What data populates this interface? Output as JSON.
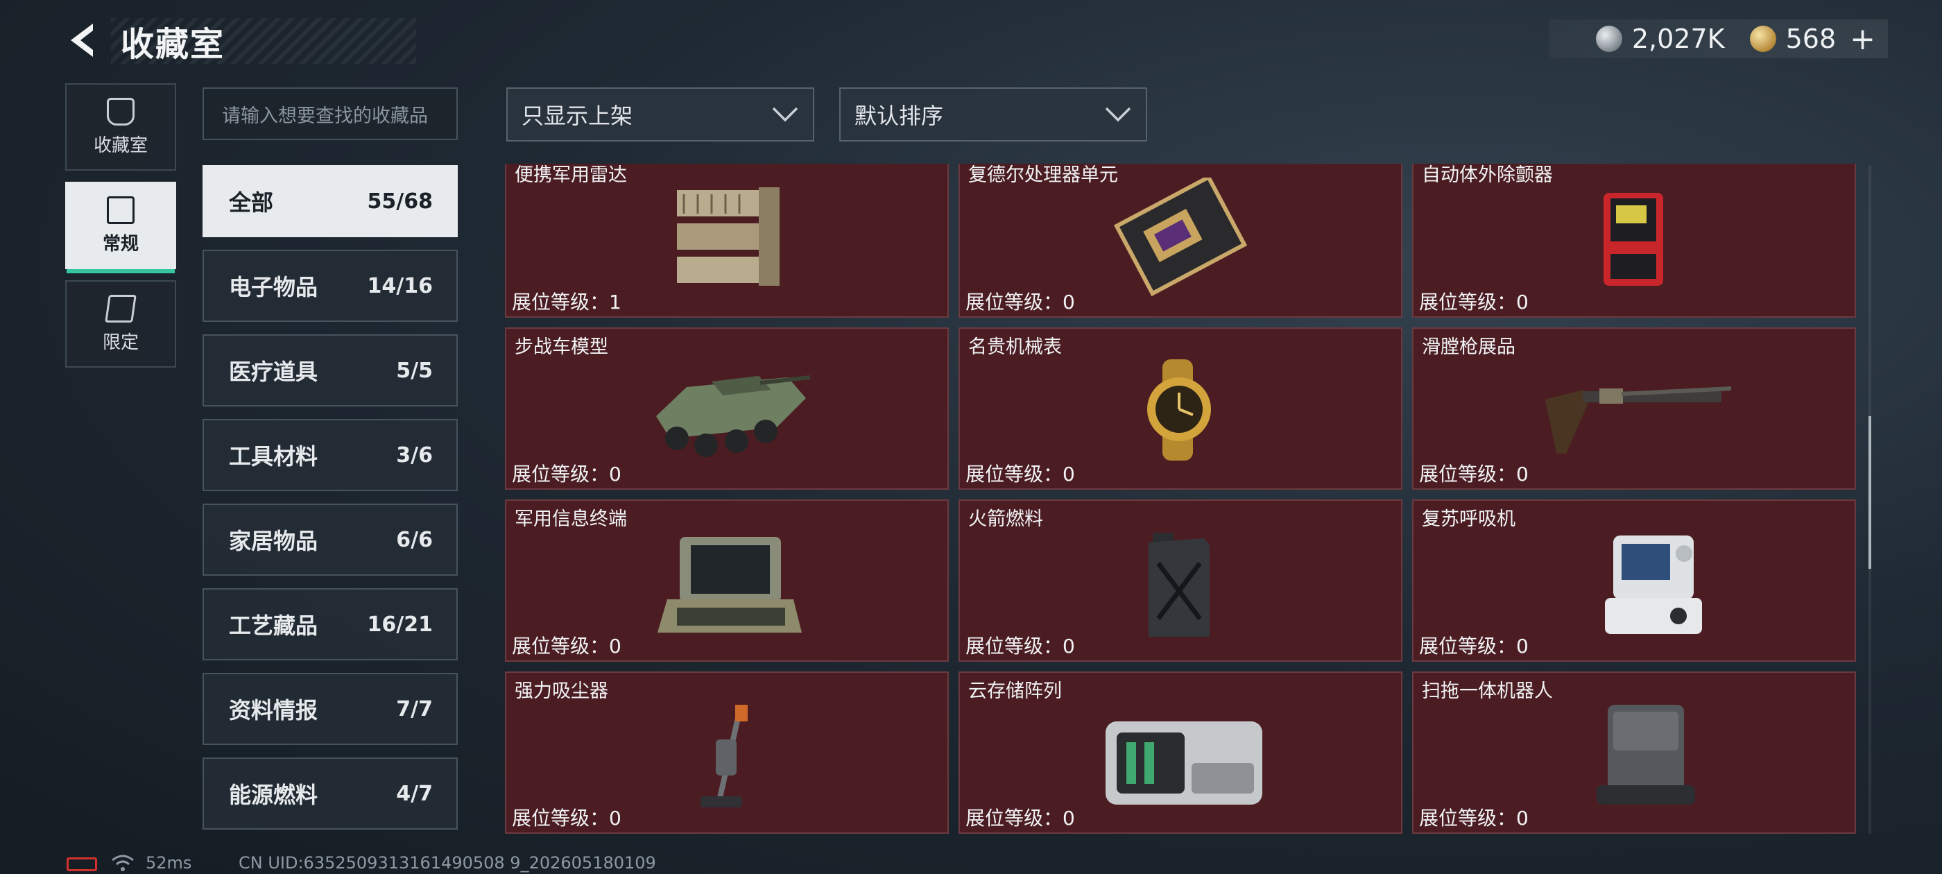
{
  "header": {
    "title": "收藏室",
    "back_icon": "back-arrow-icon",
    "currencies": [
      {
        "icon": "silver-coin-icon",
        "value": "2,027K"
      },
      {
        "icon": "gold-coin-icon",
        "value": "568"
      }
    ],
    "add_label": "+"
  },
  "nav": {
    "tabs": [
      {
        "label": "收藏室",
        "icon": "trophy-icon",
        "active": false
      },
      {
        "label": "常规",
        "icon": "collection-card-icon",
        "active": true
      },
      {
        "label": "限定",
        "icon": "limited-icon",
        "active": false
      }
    ]
  },
  "search": {
    "placeholder": "请输入想要查找的收藏品"
  },
  "filters": {
    "shelf_filter": "只显示上架",
    "sort_order": "默认排序"
  },
  "categories": [
    {
      "name": "全部",
      "count": "55/68",
      "active": true
    },
    {
      "name": "电子物品",
      "count": "14/16"
    },
    {
      "name": "医疗道具",
      "count": "5/5"
    },
    {
      "name": "工具材料",
      "count": "3/6"
    },
    {
      "name": "家居物品",
      "count": "6/6"
    },
    {
      "name": "工艺藏品",
      "count": "16/21"
    },
    {
      "name": "资料情报",
      "count": "7/7"
    },
    {
      "name": "能源燃料",
      "count": "4/7"
    }
  ],
  "level_label": "展位等级：",
  "items": [
    {
      "name": "便携军用雷达",
      "level": "1",
      "icon": "portable-radar-icon"
    },
    {
      "name": "复德尔处理器单元",
      "level": "0",
      "icon": "processor-unit-icon"
    },
    {
      "name": "自动体外除颤器",
      "level": "0",
      "icon": "defibrillator-icon"
    },
    {
      "name": "步战车模型",
      "level": "0",
      "icon": "ifv-model-icon"
    },
    {
      "name": "名贵机械表",
      "level": "0",
      "icon": "mechanical-watch-icon"
    },
    {
      "name": "滑膛枪展品",
      "level": "0",
      "icon": "musket-icon"
    },
    {
      "name": "军用信息终端",
      "level": "0",
      "icon": "military-terminal-icon"
    },
    {
      "name": "火箭燃料",
      "level": "0",
      "icon": "rocket-fuel-can-icon"
    },
    {
      "name": "复苏呼吸机",
      "level": "0",
      "icon": "ventilator-icon"
    },
    {
      "name": "强力吸尘器",
      "level": "0",
      "icon": "vacuum-cleaner-icon"
    },
    {
      "name": "云存储阵列",
      "level": "0",
      "icon": "cloud-storage-array-icon"
    },
    {
      "name": "扫拖一体机器人",
      "level": "0",
      "icon": "mopping-robot-icon"
    }
  ],
  "status": {
    "ping": "52ms",
    "uid": "CN UID:6352509313161490508 9_202605180109"
  }
}
